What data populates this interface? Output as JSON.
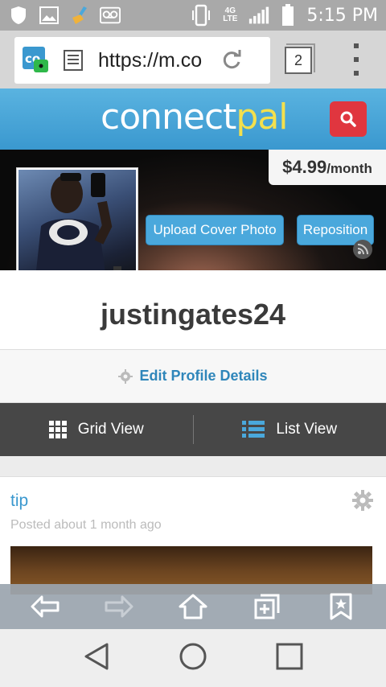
{
  "status_bar": {
    "time": "5:15 PM",
    "network": "4G LTE",
    "icons": [
      "shield-icon",
      "image-icon",
      "broom-icon",
      "voicemail-icon",
      "vibrate-icon",
      "signal-icon",
      "battery-icon"
    ]
  },
  "browser": {
    "url": "https://m.co",
    "tab_count": "2",
    "icons": [
      "site-icon",
      "lock-icon",
      "reader-icon",
      "reload-icon",
      "tabs-icon",
      "menu-icon"
    ]
  },
  "header": {
    "logo_part1": "connect",
    "logo_part2": "pal",
    "search_icon": "search-icon",
    "brand_color": "#3a98cf",
    "accent_yellow": "#f4e04d",
    "search_color": "#e0363f"
  },
  "profile": {
    "price": "$4.99",
    "price_period": "/month",
    "upload_cover_label": "Upload Cover Photo",
    "reposition_label": "Reposition",
    "username": "justingates24",
    "edit_label": "Edit Profile Details"
  },
  "view_toggle": {
    "grid_label": "Grid View",
    "list_label": "List View"
  },
  "post": {
    "title": "tip",
    "meta": "Posted about 1 month ago"
  },
  "browser_nav": {
    "icons": [
      "back-icon",
      "forward-icon",
      "home-icon",
      "new-tab-icon",
      "bookmark-icon"
    ]
  },
  "android_nav": {
    "icons": [
      "back-triangle-icon",
      "home-circle-icon",
      "recents-square-icon"
    ]
  }
}
